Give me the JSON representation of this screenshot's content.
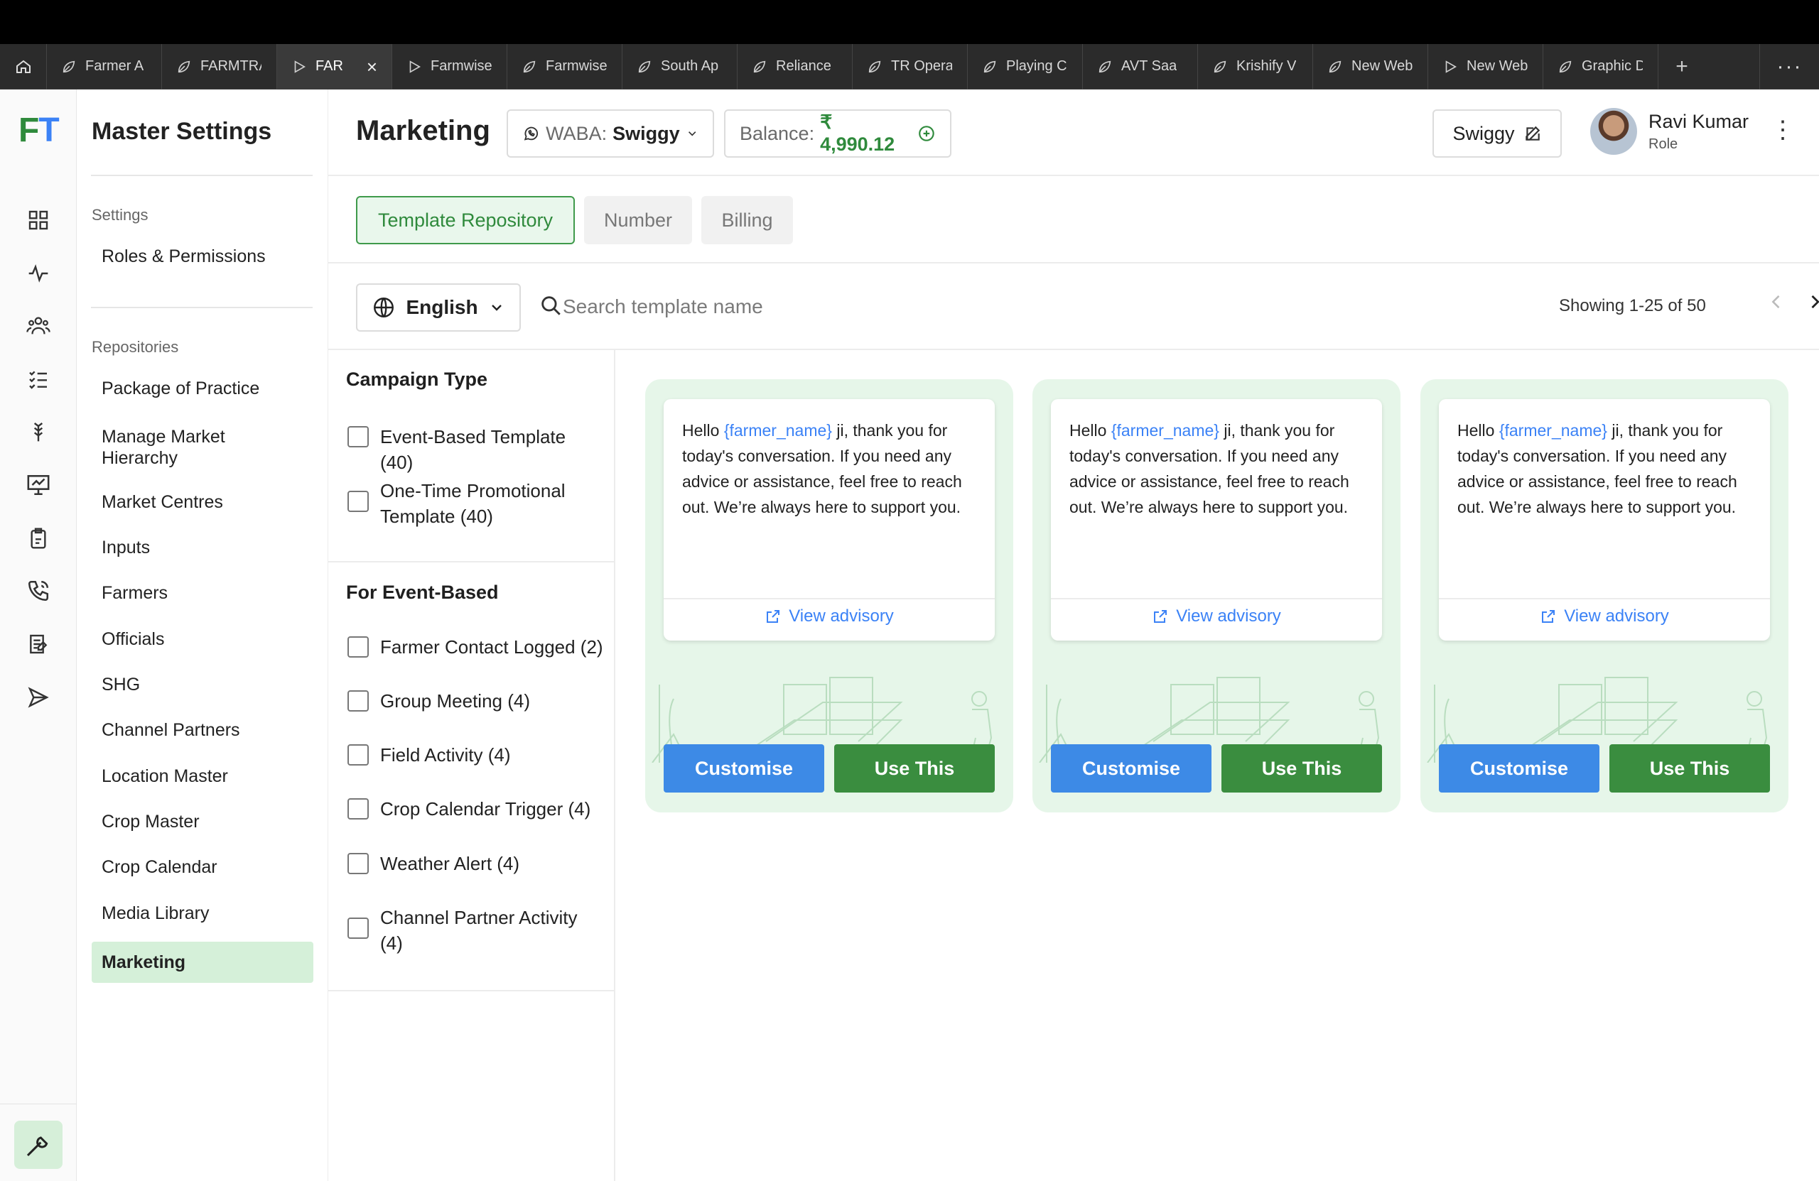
{
  "browser": {
    "tabs": [
      {
        "label": "Farmer A",
        "icon": "leaf-icon"
      },
      {
        "label": "FARMTRA",
        "icon": "leaf-icon"
      },
      {
        "label": "FAR",
        "icon": "play-icon",
        "active": true
      },
      {
        "label": "Farmwise",
        "icon": "play-icon"
      },
      {
        "label": "Farmwise",
        "icon": "leaf-icon"
      },
      {
        "label": "South Ap",
        "icon": "leaf-icon"
      },
      {
        "label": "Reliance",
        "icon": "leaf-icon"
      },
      {
        "label": "TR Opera",
        "icon": "leaf-icon"
      },
      {
        "label": "Playing C",
        "icon": "leaf-icon"
      },
      {
        "label": "AVT Saa",
        "icon": "leaf-icon"
      },
      {
        "label": "Krishify V",
        "icon": "leaf-icon"
      },
      {
        "label": "New Web",
        "icon": "leaf-icon"
      },
      {
        "label": "New Web",
        "icon": "play-icon"
      },
      {
        "label": "Graphic D",
        "icon": "leaf-icon"
      }
    ],
    "new_tab": "+",
    "more": "···"
  },
  "rail": {
    "logo_f": "F",
    "logo_t": "T",
    "icons": [
      "grid-icon",
      "activity-icon",
      "users-icon",
      "checklist-icon",
      "wheat-icon",
      "presentation-icon",
      "clipboard-icon",
      "phone-icon",
      "report-icon",
      "send-icon"
    ],
    "bottom_icon": "wrench-icon"
  },
  "sidebar": {
    "title": "Master Settings",
    "settings_label": "Settings",
    "settings_items": [
      "Roles & Permissions"
    ],
    "repositories_label": "Repositories",
    "repo_items": [
      "Package of Practice",
      "Manage Market Hierarchy",
      "Market Centres",
      "Inputs",
      "Farmers",
      "Officials",
      "SHG",
      "Channel Partners",
      "Location Master",
      "Crop Master",
      "Crop Calendar",
      "Media Library",
      "Marketing"
    ],
    "active_item": "Marketing"
  },
  "header": {
    "title": "Marketing",
    "waba_label": "WABA:",
    "waba_value": "Swiggy",
    "balance_label": "Balance:",
    "balance_value": "₹ 4,990.12",
    "org_button": "Swiggy",
    "user_name": "Ravi Kumar",
    "user_role": "Role"
  },
  "tabs": {
    "items": [
      "Template Repository",
      "Number",
      "Billing"
    ],
    "active": "Template Repository"
  },
  "filterbar": {
    "language": "English",
    "search_placeholder": "Search template name",
    "search_value": "",
    "showing": "Showing 1-25 of 50"
  },
  "filters": {
    "campaign_type_title": "Campaign Type",
    "campaign_types": [
      "Event-Based Template (40)",
      "One-Time Promotional Template (40)"
    ],
    "event_based_title": "For Event-Based",
    "event_types": [
      "Farmer Contact Logged (2)",
      "Group Meeting (4)",
      "Field Activity (4)",
      "Crop Calendar Trigger (4)",
      "Weather Alert (4)",
      "Channel Partner Activity (4)"
    ]
  },
  "cards": [
    {
      "msg_pre": "Hello ",
      "msg_var": "{farmer_name}",
      "msg_post": " ji, thank you for today's conversation. If you need any advice or assistance, feel free to reach out. We’re always here to support you.",
      "link": "View advisory",
      "customise": "Customise",
      "use": "Use This"
    },
    {
      "msg_pre": "Hello ",
      "msg_var": "{farmer_name}",
      "msg_post": " ji, thank you for today's conversation. If you need any advice or assistance, feel free to reach out. We’re always here to support you.",
      "link": "View advisory",
      "customise": "Customise",
      "use": "Use This"
    },
    {
      "msg_pre": "Hello ",
      "msg_var": "{farmer_name}",
      "msg_post": " ji, thank you for today's conversation. If you need any advice or assistance, feel free to reach out. We’re always here to support you.",
      "link": "View advisory",
      "customise": "Customise",
      "use": "Use This"
    }
  ],
  "colors": {
    "brand_green": "#3a8d3f",
    "accent_blue": "#3d8ae6",
    "active_bg": "#d5f0d9"
  }
}
